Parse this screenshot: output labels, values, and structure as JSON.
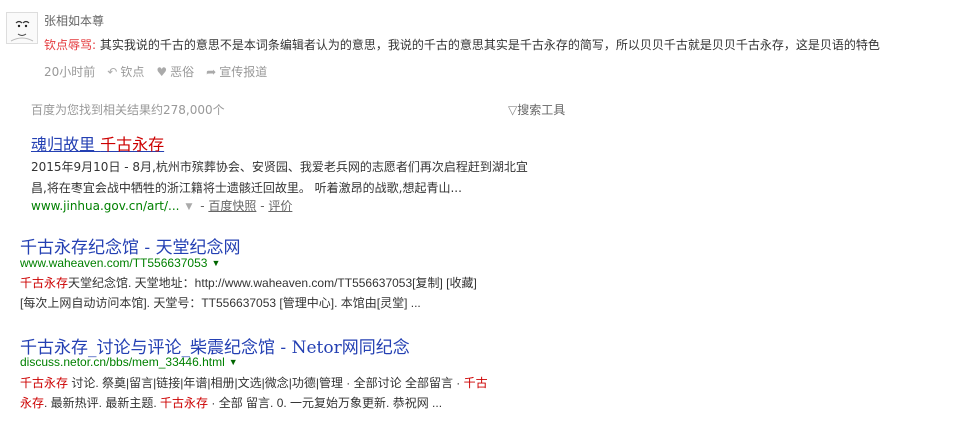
{
  "comment": {
    "user": "张相如本尊",
    "tag": "钦点辱骂:",
    "text": "其实我说的千古的意思不是本词条编辑者认为的意思，我说的千古的意思其实是千古永存的简写，所以贝贝千古就是贝贝千古永存，这是贝语的特色",
    "time": "20小时前",
    "reply": "钦点",
    "vulgar": "恶俗",
    "report": "宣传报道"
  },
  "search": {
    "count": "百度为您找到相关结果约278,000个",
    "tools": "搜索工具"
  },
  "results": [
    {
      "title_a": "魂归故里",
      "title_b": "千古永存",
      "snippet_l1": "2015年9月10日 - 8月,杭州市殡葬协会、安贤园、我爱老兵网的志愿者们再次启程赶到湖北宜",
      "snippet_l2": "昌,将在枣宜会战中牺牲的浙江籍将士遗骸迁回故里。 听着激昂的战歌,想起青山...",
      "url": "www.jinhua.gov.cn/art/...",
      "snapshot": "百度快照",
      "review": "评价"
    },
    {
      "title_a": "千古永存纪念馆",
      "title_sep": " - ",
      "title_b": "天堂纪念网",
      "url": "www.waheaven.com/TT556637053",
      "snip1_kw": "千古永存",
      "snip1_rest": "天堂纪念馆. 天堂地址：http://www.waheaven.com/TT556637053[复制] [收藏]",
      "snip2": "[每次上网自动访问本馆]. 天堂号：TT556637053 [管理中心]. 本馆由[灵堂] ..."
    },
    {
      "title_a": "千古永存_讨论与评论_柴震纪念馆",
      "title_sep": " - ",
      "title_b": "Netor网同纪念",
      "url": "discuss.netor.cn/bbs/mem_33446.html",
      "snip1_kw": "千古永存",
      "snip1_rest": " 讨论. 祭奠|留言|链接|年谱|相册|文选|微念|功德|管理 · 全部讨论 全部留言 · ",
      "snip1_kw2": "千古",
      "snip2_kw": "永存",
      "snip2_a": ". 最新热评. 最新主题. ",
      "snip2_kw2": "千古永存",
      "snip2_b": " · 全部 留言. 0. 一元复始万象更新. 恭祝网 ..."
    }
  ]
}
